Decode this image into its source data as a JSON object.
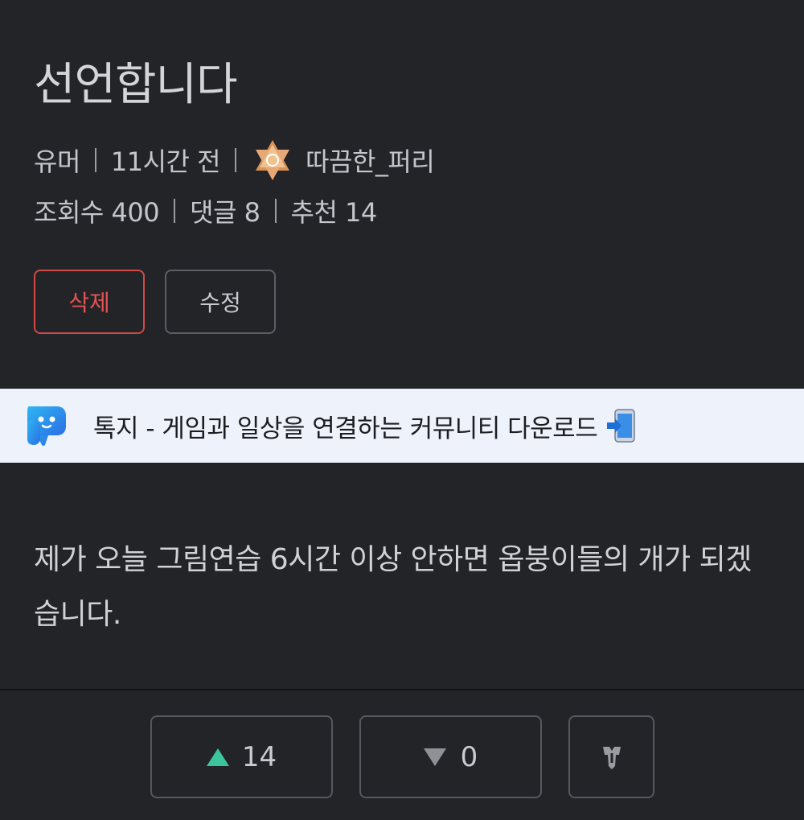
{
  "post": {
    "title": "선언합니다",
    "category": "유머",
    "time_ago": "11시간 전",
    "author": "따끔한_퍼리",
    "author_rank_icon": "rank-badge-icon",
    "views_label": "조회수 400",
    "comments_label": "댓글 8",
    "recommend_label": "추천 14",
    "body": "제가 오늘 그림연습 6시간 이상 안하면 옵붕이들의 개가 되겠습니다."
  },
  "actions": {
    "delete_label": "삭제",
    "edit_label": "수정"
  },
  "banner": {
    "text": "톡지 - 게임과 일상을 연결하는 커뮤니티 다운로드",
    "logo_icon": "app-logo-icon",
    "phone_icon": "phone-download-icon",
    "background": "#eef2fb"
  },
  "votes": {
    "up_count": "14",
    "down_count": "0",
    "up_color": "#3cc49c",
    "report_icon": "report-icon"
  },
  "colors": {
    "background": "#232428",
    "delete_accent": "#d04848"
  }
}
